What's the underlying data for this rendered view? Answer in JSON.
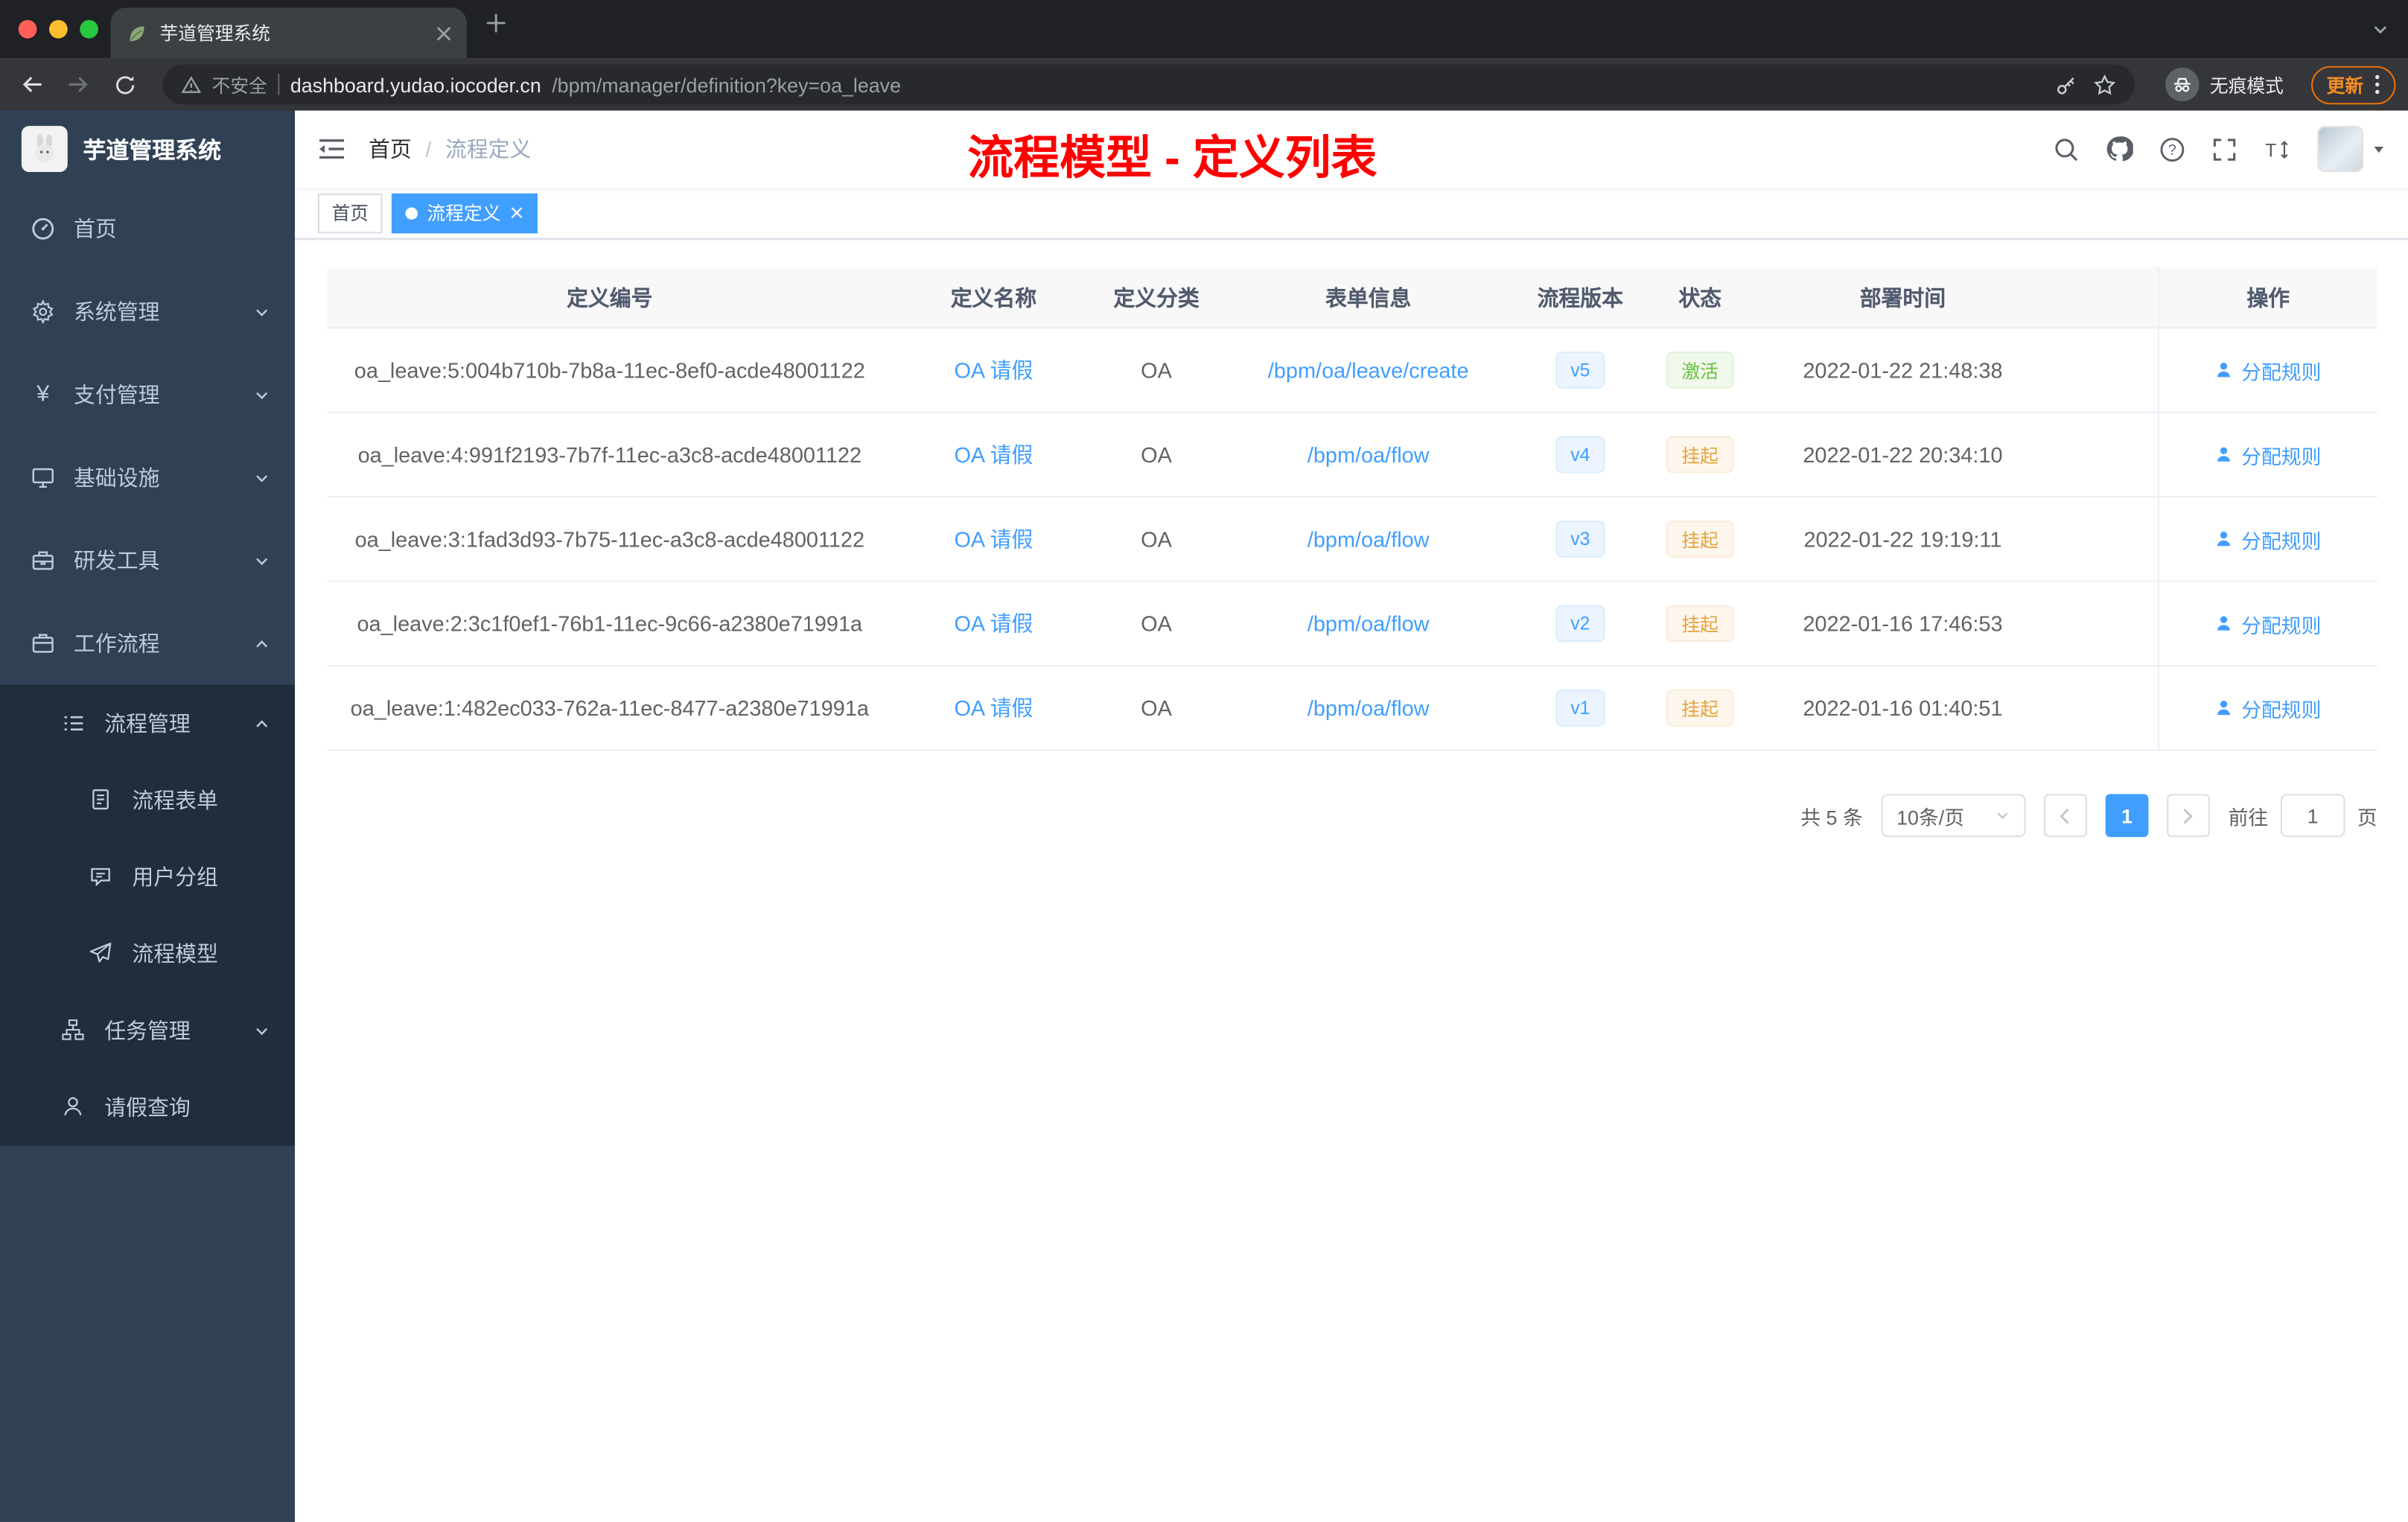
{
  "colors": {
    "accent": "#409eff",
    "annotation_red": "#ff0000",
    "status_active_green": "#67c23a",
    "status_suspend_orange": "#e6a23c",
    "sidebar_bg": "#304156",
    "submenu_bg": "#1f2d3d"
  },
  "browser": {
    "tab_title": "芋道管理系统",
    "security_label": "不安全",
    "url_host": "dashboard.yudao.iocoder.cn",
    "url_path": "/bpm/manager/definition?key=oa_leave",
    "incognito_label": "无痕模式",
    "update_label": "更新"
  },
  "sidebar": {
    "app_title": "芋道管理系统",
    "menu": {
      "home": "首页",
      "system": "系统管理",
      "payment": "支付管理",
      "infra": "基础设施",
      "devtools": "研发工具",
      "workflow": "工作流程",
      "process_mgmt": "流程管理",
      "process_form": "流程表单",
      "user_group": "用户分组",
      "process_model": "流程模型",
      "task_mgmt": "任务管理",
      "leave_query": "请假查询"
    }
  },
  "header": {
    "breadcrumb_home": "首页",
    "breadcrumb_sep": "/",
    "breadcrumb_current": "流程定义",
    "annotation": "流程模型 - 定义列表"
  },
  "tags": {
    "home": "首页",
    "current": "流程定义"
  },
  "table": {
    "columns": [
      "定义编号",
      "定义名称",
      "定义分类",
      "表单信息",
      "流程版本",
      "状态",
      "部署时间",
      "操作"
    ],
    "rows": [
      {
        "id": "oa_leave:5:004b710b-7b8a-11ec-8ef0-acde48001122",
        "name": "OA 请假",
        "category": "OA",
        "form": "/bpm/oa/leave/create",
        "version": "v5",
        "status": "激活",
        "status_class": "tag-success",
        "deploy_time": "2022-01-22 21:48:38",
        "action": "分配规则"
      },
      {
        "id": "oa_leave:4:991f2193-7b7f-11ec-a3c8-acde48001122",
        "name": "OA 请假",
        "category": "OA",
        "form": "/bpm/oa/flow",
        "version": "v4",
        "status": "挂起",
        "status_class": "tag-warning",
        "deploy_time": "2022-01-22 20:34:10",
        "action": "分配规则"
      },
      {
        "id": "oa_leave:3:1fad3d93-7b75-11ec-a3c8-acde48001122",
        "name": "OA 请假",
        "category": "OA",
        "form": "/bpm/oa/flow",
        "version": "v3",
        "status": "挂起",
        "status_class": "tag-warning",
        "deploy_time": "2022-01-22 19:19:11",
        "action": "分配规则"
      },
      {
        "id": "oa_leave:2:3c1f0ef1-76b1-11ec-9c66-a2380e71991a",
        "name": "OA 请假",
        "category": "OA",
        "form": "/bpm/oa/flow",
        "version": "v2",
        "status": "挂起",
        "status_class": "tag-warning",
        "deploy_time": "2022-01-16 17:46:53",
        "action": "分配规则"
      },
      {
        "id": "oa_leave:1:482ec033-762a-11ec-8477-a2380e71991a",
        "name": "OA 请假",
        "category": "OA",
        "form": "/bpm/oa/flow",
        "version": "v1",
        "status": "挂起",
        "status_class": "tag-warning",
        "deploy_time": "2022-01-16 01:40:51",
        "action": "分配规则"
      }
    ]
  },
  "pagination": {
    "total": "共 5 条",
    "page_size": "10条/页",
    "current_page": "1",
    "goto_label": "前往",
    "goto_value": "1",
    "page_unit": "页"
  }
}
